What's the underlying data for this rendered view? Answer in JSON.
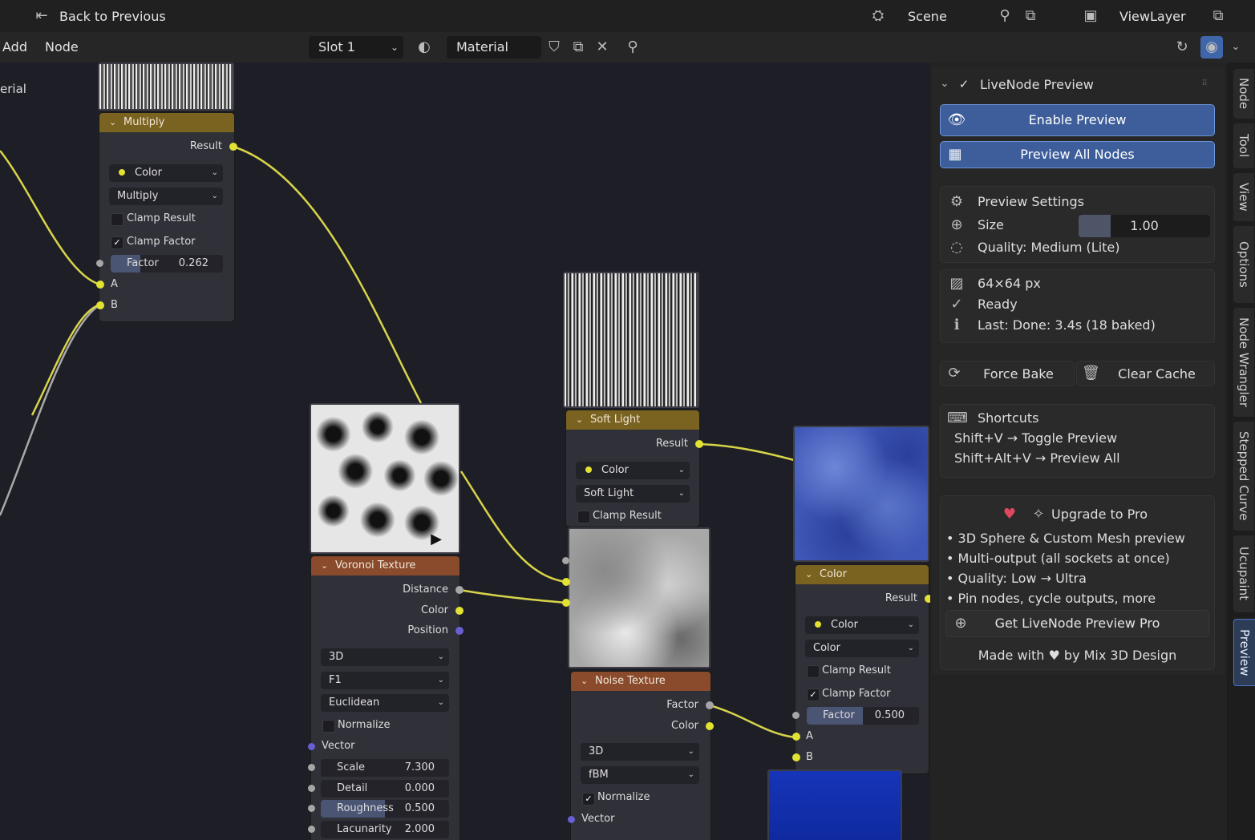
{
  "topbar": {
    "back_label": "Back to Previous",
    "scene_label": "Scene",
    "viewlayer_label": "ViewLayer"
  },
  "header": {
    "add_label": "Add",
    "node_label": "Node",
    "slot_value": "Slot 1",
    "material_value": "Material"
  },
  "canvas": {
    "edge_label": "erial",
    "multiply_node": {
      "title": "Multiply",
      "result": "Result",
      "data_type": "Color",
      "blend_mode": "Multiply",
      "clamp_result": "Clamp Result",
      "clamp_factor": "Clamp Factor",
      "factor_label": "Factor",
      "factor_value": "0.262",
      "factor_fraction": 0.262,
      "input_a": "A",
      "input_b": "B"
    },
    "voronoi_node": {
      "title": "Voronoi Texture",
      "out_distance": "Distance",
      "out_color": "Color",
      "out_position": "Position",
      "dimensions": "3D",
      "feature": "F1",
      "metric": "Euclidean",
      "normalize": "Normalize",
      "vector": "Vector",
      "scale_label": "Scale",
      "scale_value": "7.300",
      "detail_label": "Detail",
      "detail_value": "0.000",
      "roughness_label": "Roughness",
      "roughness_value": "0.500",
      "lacunarity_label": "Lacunarity",
      "lacunarity_value": "2.000"
    },
    "softlight_node": {
      "title": "Soft Light",
      "result": "Result",
      "data_type": "Color",
      "blend_mode": "Soft Light",
      "clamp_result": "Clamp Result"
    },
    "noise_node": {
      "title": "Noise Texture",
      "out_factor": "Factor",
      "out_color": "Color",
      "dimensions": "3D",
      "type": "fBM",
      "normalize": "Normalize",
      "vector": "Vector"
    },
    "color_node": {
      "title": "Color",
      "result": "Result",
      "data_type": "Color",
      "blend_mode": "Color",
      "clamp_result": "Clamp Result",
      "clamp_factor": "Clamp Factor",
      "factor_label": "Factor",
      "factor_value": "0.500",
      "factor_fraction": 0.5,
      "input_a": "A",
      "input_b": "B"
    }
  },
  "panel": {
    "title": "LiveNode Preview",
    "enable_preview": "Enable Preview",
    "preview_all": "Preview All Nodes",
    "settings_title": "Preview Settings",
    "size_label": "Size",
    "size_value": "1.00",
    "quality": "Quality: Medium (Lite)",
    "resolution": "64×64 px",
    "status": "Ready",
    "last": "Last: Done: 3.4s (18 baked)",
    "force_bake": "Force Bake",
    "clear_cache": "Clear Cache",
    "shortcuts_title": "Shortcuts",
    "shortcut_1": "Shift+V → Toggle Preview",
    "shortcut_2": "Shift+Alt+V → Preview All",
    "upgrade_title": "Upgrade to Pro",
    "bullet_1": "• 3D Sphere & Custom Mesh preview",
    "bullet_2": "• Multi-output (all sockets at once)",
    "bullet_3": "• Quality: Low → Ultra",
    "bullet_4": "• Pin nodes, cycle outputs, more",
    "get_pro": "Get LiveNode Preview Pro",
    "made_with": "Made with ♥ by Mix 3D Design"
  },
  "tabs": [
    "Node",
    "Tool",
    "View",
    "Options",
    "Node Wrangler",
    "Stepped Curve",
    "Ucupaint",
    "Preview"
  ],
  "colors": {
    "accent_blue": "#4a78c8",
    "socket_yellow": "#e2e233",
    "socket_purple": "#6a5fd0",
    "node_header_mix": "#7a6220",
    "node_header_texture": "#8a4a2c"
  }
}
